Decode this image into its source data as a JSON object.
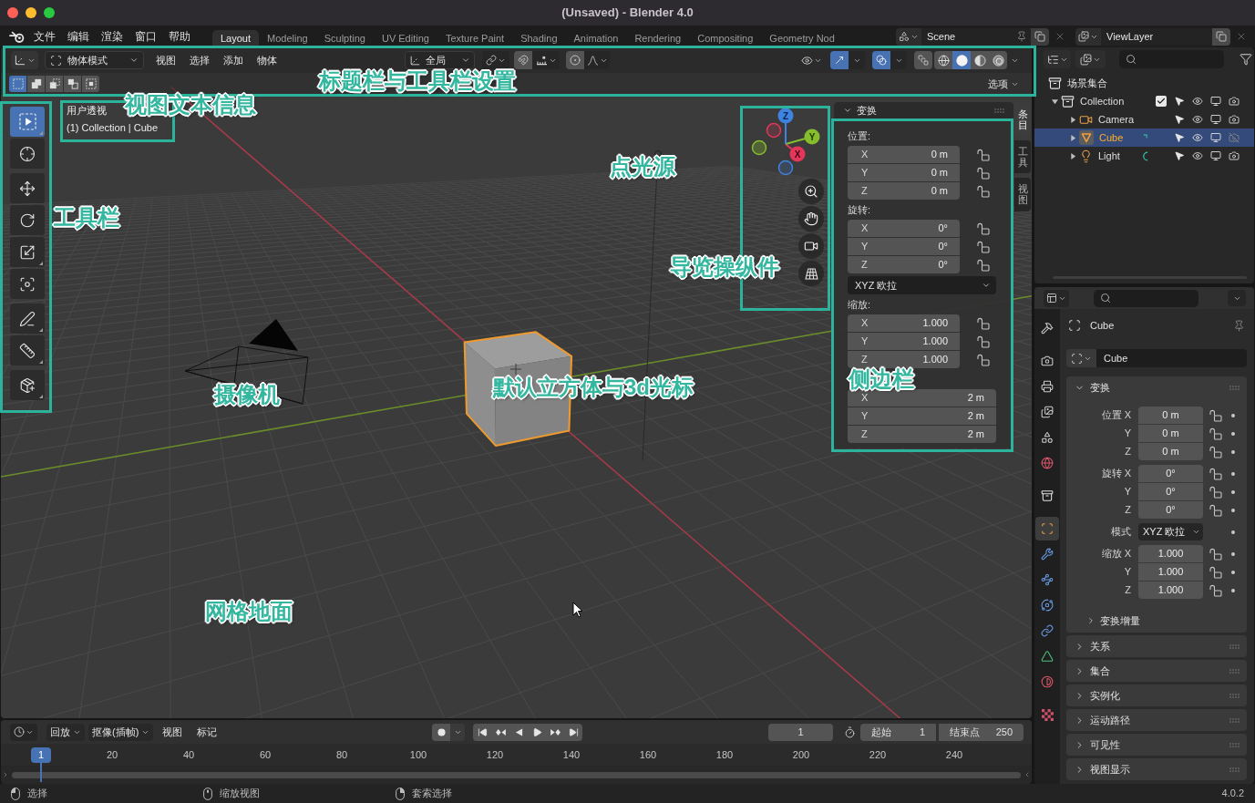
{
  "window": {
    "title": "(Unsaved) - Blender 4.0"
  },
  "topbar": {
    "menus": [
      "文件",
      "编辑",
      "渲染",
      "窗口",
      "帮助"
    ],
    "workspaces": [
      {
        "label": "Layout",
        "selected": true
      },
      {
        "label": "Modeling",
        "selected": false
      },
      {
        "label": "Sculpting",
        "selected": false
      },
      {
        "label": "UV Editing",
        "selected": false
      },
      {
        "label": "Texture Paint",
        "selected": false
      },
      {
        "label": "Shading",
        "selected": false
      },
      {
        "label": "Animation",
        "selected": false
      },
      {
        "label": "Rendering",
        "selected": false
      },
      {
        "label": "Compositing",
        "selected": false
      },
      {
        "label": "Geometry Nod",
        "selected": false
      }
    ],
    "scene": "Scene",
    "view_layer": "ViewLayer"
  },
  "viewport": {
    "header": {
      "mode": "物体模式",
      "menus": [
        "视图",
        "选择",
        "添加",
        "物体"
      ],
      "orientation": "全局",
      "toggles": {
        "snap": false,
        "proportional": false,
        "gizmos": true,
        "overlays": true,
        "xray": false
      },
      "shading": [
        {
          "kind": "wireframe",
          "selected": false
        },
        {
          "kind": "solid",
          "selected": true
        },
        {
          "kind": "material",
          "selected": false
        },
        {
          "kind": "rendered",
          "selected": false
        }
      ],
      "select_modes": [
        {
          "kind": "set",
          "selected": true
        },
        {
          "kind": "extend",
          "selected": false
        },
        {
          "kind": "subtract",
          "selected": false
        },
        {
          "kind": "invert",
          "selected": false
        },
        {
          "kind": "intersect",
          "selected": false
        }
      ],
      "options": "选项"
    },
    "info": [
      "用户透视",
      "(1) Collection | Cube"
    ],
    "tools": [
      {
        "kind": "select_box",
        "selected": true
      },
      {
        "kind": "cursor",
        "selected": false
      },
      {
        "kind": "move",
        "selected": false
      },
      {
        "kind": "rotate",
        "selected": false
      },
      {
        "kind": "scale",
        "selected": false
      },
      {
        "kind": "transform",
        "selected": false
      },
      {
        "kind": "annotate",
        "selected": false
      },
      {
        "kind": "measure",
        "selected": false
      },
      {
        "kind": "add_cube",
        "selected": false
      }
    ],
    "gizmo_axes": [
      "X",
      "Y",
      "Z"
    ],
    "sidebar": {
      "tabs": [
        {
          "label": "条目",
          "selected": true
        },
        {
          "label": "工具",
          "selected": false
        },
        {
          "label": "视图",
          "selected": false
        }
      ],
      "panel": {
        "title": "变换",
        "expanded": true
      },
      "groups": [
        {
          "kind": "vector",
          "label": "位置:",
          "fields": [
            {
              "axis": "X",
              "value": "0 m",
              "locked": false
            },
            {
              "axis": "Y",
              "value": "0 m",
              "locked": false
            },
            {
              "axis": "Z",
              "value": "0 m",
              "locked": false
            }
          ]
        },
        {
          "kind": "vector",
          "label": "旋转:",
          "fields": [
            {
              "axis": "X",
              "value": "0°",
              "locked": false
            },
            {
              "axis": "Y",
              "value": "0°",
              "locked": false
            },
            {
              "axis": "Z",
              "value": "0°",
              "locked": false
            }
          ]
        },
        {
          "kind": "dropdown",
          "value": "XYZ 欧拉"
        },
        {
          "kind": "vector",
          "label": "缩放:",
          "fields": [
            {
              "axis": "X",
              "value": "1.000",
              "locked": false
            },
            {
              "axis": "Y",
              "value": "1.000",
              "locked": false
            },
            {
              "axis": "Z",
              "value": "1.000",
              "locked": false
            }
          ]
        },
        {
          "kind": "vector",
          "fields": [
            {
              "axis": "X",
              "value": "2 m"
            },
            {
              "axis": "Y",
              "value": "2 m"
            },
            {
              "axis": "Z",
              "value": "2 m"
            }
          ]
        }
      ]
    }
  },
  "outliner": {
    "root": "场景集合",
    "items": [
      {
        "name": "Collection",
        "kind": "collection",
        "expanded": true,
        "checked": true,
        "selected": false,
        "children": [
          {
            "name": "Camera",
            "kind": "camera",
            "expanded": false,
            "selected": false,
            "renderable": true
          },
          {
            "name": "Cube",
            "kind": "mesh",
            "expanded": false,
            "selected": true,
            "renderable": false
          },
          {
            "name": "Light",
            "kind": "light",
            "expanded": false,
            "selected": false,
            "renderable": true
          }
        ]
      }
    ]
  },
  "properties": {
    "tabs": [
      {
        "kind": "tool",
        "selected": false
      },
      {
        "kind": "render",
        "selected": false
      },
      {
        "kind": "output",
        "selected": false
      },
      {
        "kind": "view_layer",
        "selected": false
      },
      {
        "kind": "scene",
        "selected": false
      },
      {
        "kind": "world",
        "selected": false
      },
      {
        "kind": "collection",
        "selected": false
      },
      {
        "kind": "object",
        "selected": true
      },
      {
        "kind": "modifiers",
        "selected": false
      },
      {
        "kind": "particles",
        "selected": false
      },
      {
        "kind": "physics",
        "selected": false
      },
      {
        "kind": "constraints",
        "selected": false
      },
      {
        "kind": "data",
        "selected": false
      },
      {
        "kind": "material",
        "selected": false
      },
      {
        "kind": "texture",
        "selected": false
      }
    ],
    "context": "Cube",
    "name": "Cube",
    "panels": [
      {
        "title": "变换",
        "expanded": true,
        "groups": [
          {
            "rows": [
              {
                "kind": "number",
                "label": "位置 X",
                "value": "0 m",
                "locked": false
              },
              {
                "kind": "number",
                "label": "Y",
                "value": "0 m",
                "locked": false
              },
              {
                "kind": "number",
                "label": "Z",
                "value": "0 m",
                "locked": false
              }
            ]
          },
          {
            "rows": [
              {
                "kind": "number",
                "label": "旋转 X",
                "value": "0°",
                "locked": false
              },
              {
                "kind": "number",
                "label": "Y",
                "value": "0°",
                "locked": false
              },
              {
                "kind": "number",
                "label": "Z",
                "value": "0°",
                "locked": false
              }
            ]
          },
          {
            "rows": [
              {
                "kind": "dropdown",
                "label": "模式",
                "value": "XYZ 欧拉"
              }
            ]
          },
          {
            "rows": [
              {
                "kind": "number",
                "label": "缩放 X",
                "value": "1.000",
                "locked": false
              },
              {
                "kind": "number",
                "label": "Y",
                "value": "1.000",
                "locked": false
              },
              {
                "kind": "number",
                "label": "Z",
                "value": "1.000",
                "locked": false
              }
            ]
          }
        ],
        "subpanels": [
          {
            "title": "变换增量",
            "expanded": false
          }
        ]
      },
      {
        "title": "关系",
        "expanded": false
      },
      {
        "title": "集合",
        "expanded": false
      },
      {
        "title": "实例化",
        "expanded": false
      },
      {
        "title": "运动路径",
        "expanded": false
      },
      {
        "title": "可见性",
        "expanded": false
      },
      {
        "title": "视图显示",
        "expanded": false
      }
    ]
  },
  "timeline": {
    "menus": [
      {
        "label": "回放",
        "dropdown": true
      },
      {
        "label": "抠像(插帧)",
        "dropdown": true
      },
      {
        "label": "视图",
        "dropdown": false
      },
      {
        "label": "标记",
        "dropdown": false
      }
    ],
    "auto_keying": false,
    "current_frame": "1",
    "start": {
      "label": "起始",
      "value": "1"
    },
    "end": {
      "label": "结束点",
      "value": "250"
    },
    "ticks": [
      {
        "label": "1",
        "current": true
      },
      {
        "label": "20",
        "current": false
      },
      {
        "label": "40",
        "current": false
      },
      {
        "label": "60",
        "current": false
      },
      {
        "label": "80",
        "current": false
      },
      {
        "label": "100",
        "current": false
      },
      {
        "label": "120",
        "current": false
      },
      {
        "label": "140",
        "current": false
      },
      {
        "label": "160",
        "current": false
      },
      {
        "label": "180",
        "current": false
      },
      {
        "label": "200",
        "current": false
      },
      {
        "label": "220",
        "current": false
      },
      {
        "label": "240",
        "current": false
      }
    ]
  },
  "status_bar": {
    "hints": [
      {
        "kind": "left",
        "label": "选择"
      },
      {
        "kind": "middle",
        "label": "缩放视图"
      },
      {
        "kind": "right",
        "label": "套索选择"
      }
    ],
    "version": "4.0.2"
  },
  "annotations": [
    "标题栏与工具栏设置",
    "视图文本信息",
    "工具栏",
    "点光源",
    "导览操纵件",
    "摄像机",
    "默认立方体与3d光标",
    "侧边栏",
    "网格地面"
  ]
}
